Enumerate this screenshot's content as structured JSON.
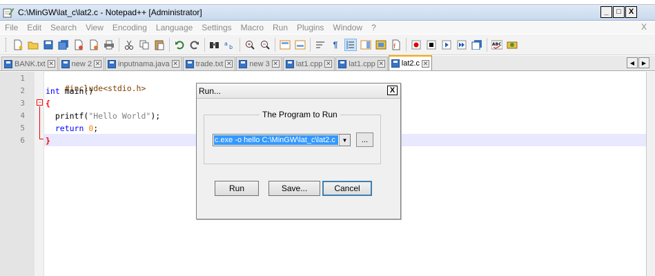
{
  "window": {
    "title": "C:\\MinGW\\lat_c\\lat2.c - Notepad++ [Administrator]",
    "minimize": "_",
    "maximize": "□",
    "close": "X"
  },
  "menu": {
    "items": [
      "File",
      "Edit",
      "Search",
      "View",
      "Encoding",
      "Language",
      "Settings",
      "Macro",
      "Run",
      "Plugins",
      "Window",
      "?"
    ],
    "close": "X"
  },
  "tabs": [
    {
      "label": "BANK.txt",
      "active": false
    },
    {
      "label": "new  2",
      "active": false
    },
    {
      "label": "inputnama.java",
      "active": false
    },
    {
      "label": "trade.txt",
      "active": false
    },
    {
      "label": "new  3",
      "active": false
    },
    {
      "label": "lat1.cpp",
      "active": false
    },
    {
      "label": "lat1.cpp",
      "active": false
    },
    {
      "label": "lat2.c",
      "active": true
    }
  ],
  "editor": {
    "line_numbers": [
      "1",
      "2",
      "3",
      "4",
      "5",
      "6"
    ],
    "code": {
      "l1": "#include<stdio.h>",
      "l2_kw": "int",
      "l2_rest": " main()",
      "l3": "{",
      "l4_fn": "  printf(",
      "l4_str": "\"Hello World\"",
      "l4_end": ");",
      "l5_kw": "  return",
      "l5_num": " 0",
      "l5_end": ";",
      "l6": "}"
    }
  },
  "run_dialog": {
    "title": "Run...",
    "close": "X",
    "group_label": "The Program to Run",
    "command_value": "c.exe  -o hello C:\\MinGW\\lat_c\\lat2.c",
    "browse_label": "...",
    "run_label": "Run",
    "save_label": "Save...",
    "cancel_label": "Cancel"
  },
  "colors": {
    "keyword": "#0000ff",
    "preprocessor": "#804000",
    "string": "#808080",
    "number": "#ff8000",
    "brace": "#ff0000",
    "selection": "#3399ff"
  }
}
